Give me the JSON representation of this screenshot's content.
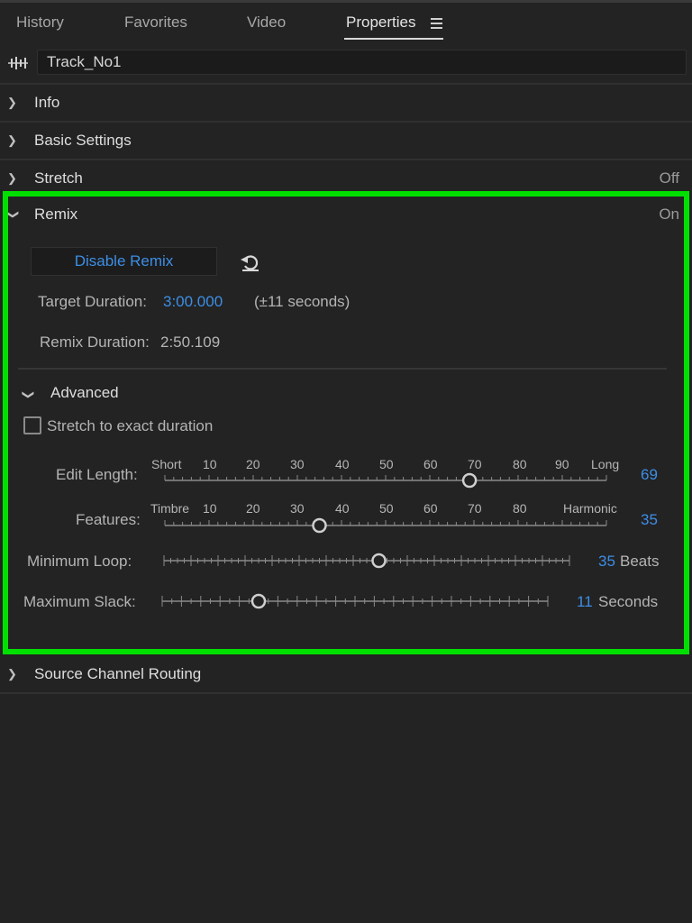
{
  "tabs": [
    {
      "label": "History"
    },
    {
      "label": "Favorites"
    },
    {
      "label": "Video"
    },
    {
      "label": "Properties"
    }
  ],
  "track": {
    "name": "Track_No1",
    "icon": "waveform-icon"
  },
  "sections": {
    "info": {
      "label": "Info"
    },
    "basic": {
      "label": "Basic Settings"
    },
    "stretch": {
      "label": "Stretch",
      "state": "Off"
    },
    "remix": {
      "label": "Remix",
      "state": "On"
    },
    "routing": {
      "label": "Source Channel Routing"
    }
  },
  "remix": {
    "disable_button": "Disable Remix",
    "target_label": "Target Duration:",
    "target_value": "3:00.000",
    "target_note": "(±11 seconds)",
    "remix_label": "Remix Duration:",
    "remix_value": "2:50.109",
    "advanced_label": "Advanced",
    "checkbox_label": "Stretch to exact duration",
    "checkbox_checked": false,
    "edit_length": {
      "label": "Edit Length:",
      "ticks": [
        "Short",
        "10",
        "20",
        "30",
        "40",
        "50",
        "60",
        "70",
        "80",
        "90",
        "Long"
      ],
      "value": "69",
      "level": 69
    },
    "features": {
      "label": "Features:",
      "ticks": [
        "Timbre",
        "10",
        "20",
        "30",
        "40",
        "50",
        "60",
        "70",
        "80",
        "Harmonic"
      ],
      "value": "35",
      "level": 35
    },
    "min_loop": {
      "label": "Minimum Loop:",
      "value": "35",
      "unit": "Beats",
      "fraction": 0.53
    },
    "max_slack": {
      "label": "Maximum Slack:",
      "value": "11",
      "unit": "Seconds",
      "fraction": 0.25
    }
  },
  "colors": {
    "accent": "#3d8ee6",
    "highlight_border": "#00e000",
    "background": "#232323"
  }
}
